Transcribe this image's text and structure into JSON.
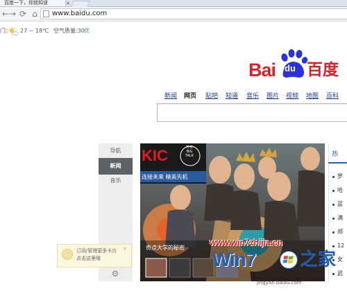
{
  "browser": {
    "tab_title": "百度一下，你就知道",
    "url": "www.baidu.com"
  },
  "weather": {
    "city": "门：",
    "temperature": "27 ~ 18℃",
    "air_quality_label": "空气质量:30",
    "air_quality_level": "优",
    "icon": "partly-cloudy-icon"
  },
  "logo": {
    "bai": "Bai",
    "du": "du",
    "cn": "百度"
  },
  "search_nav": [
    "新闻",
    "网页",
    "贴吧",
    "知道",
    "音乐",
    "图片",
    "视频",
    "地图",
    "百科"
  ],
  "rail": {
    "items": [
      "导航",
      "新闻",
      "音乐"
    ],
    "active_index": 1
  },
  "subscribe_tip": {
    "line1": "订阅/管理更多卡片",
    "line2": "点击这里哦"
  },
  "hero": {
    "logo_text": "KIC",
    "badge_line1": "THE",
    "badge_line2": "BIG",
    "badge_line3": "TALK",
    "banner_text": "连接未来 精英先机",
    "caption": "奇点大学的秘密"
  },
  "right_panel": {
    "tab": "热",
    "items": [
      "罗",
      "哈",
      "蓝",
      "满",
      "郑",
      "12",
      "女",
      "武"
    ]
  },
  "watermark": {
    "url": "www.win7zhijia.cn",
    "brand": "Win7",
    "home": "之家",
    "sub": "jingyan.baidu.com"
  },
  "colors": {
    "baidu_red": "#de1f26",
    "baidu_blue": "#2932e1",
    "link_blue": "#1a3ba4",
    "rail_active": "#5d6267"
  }
}
